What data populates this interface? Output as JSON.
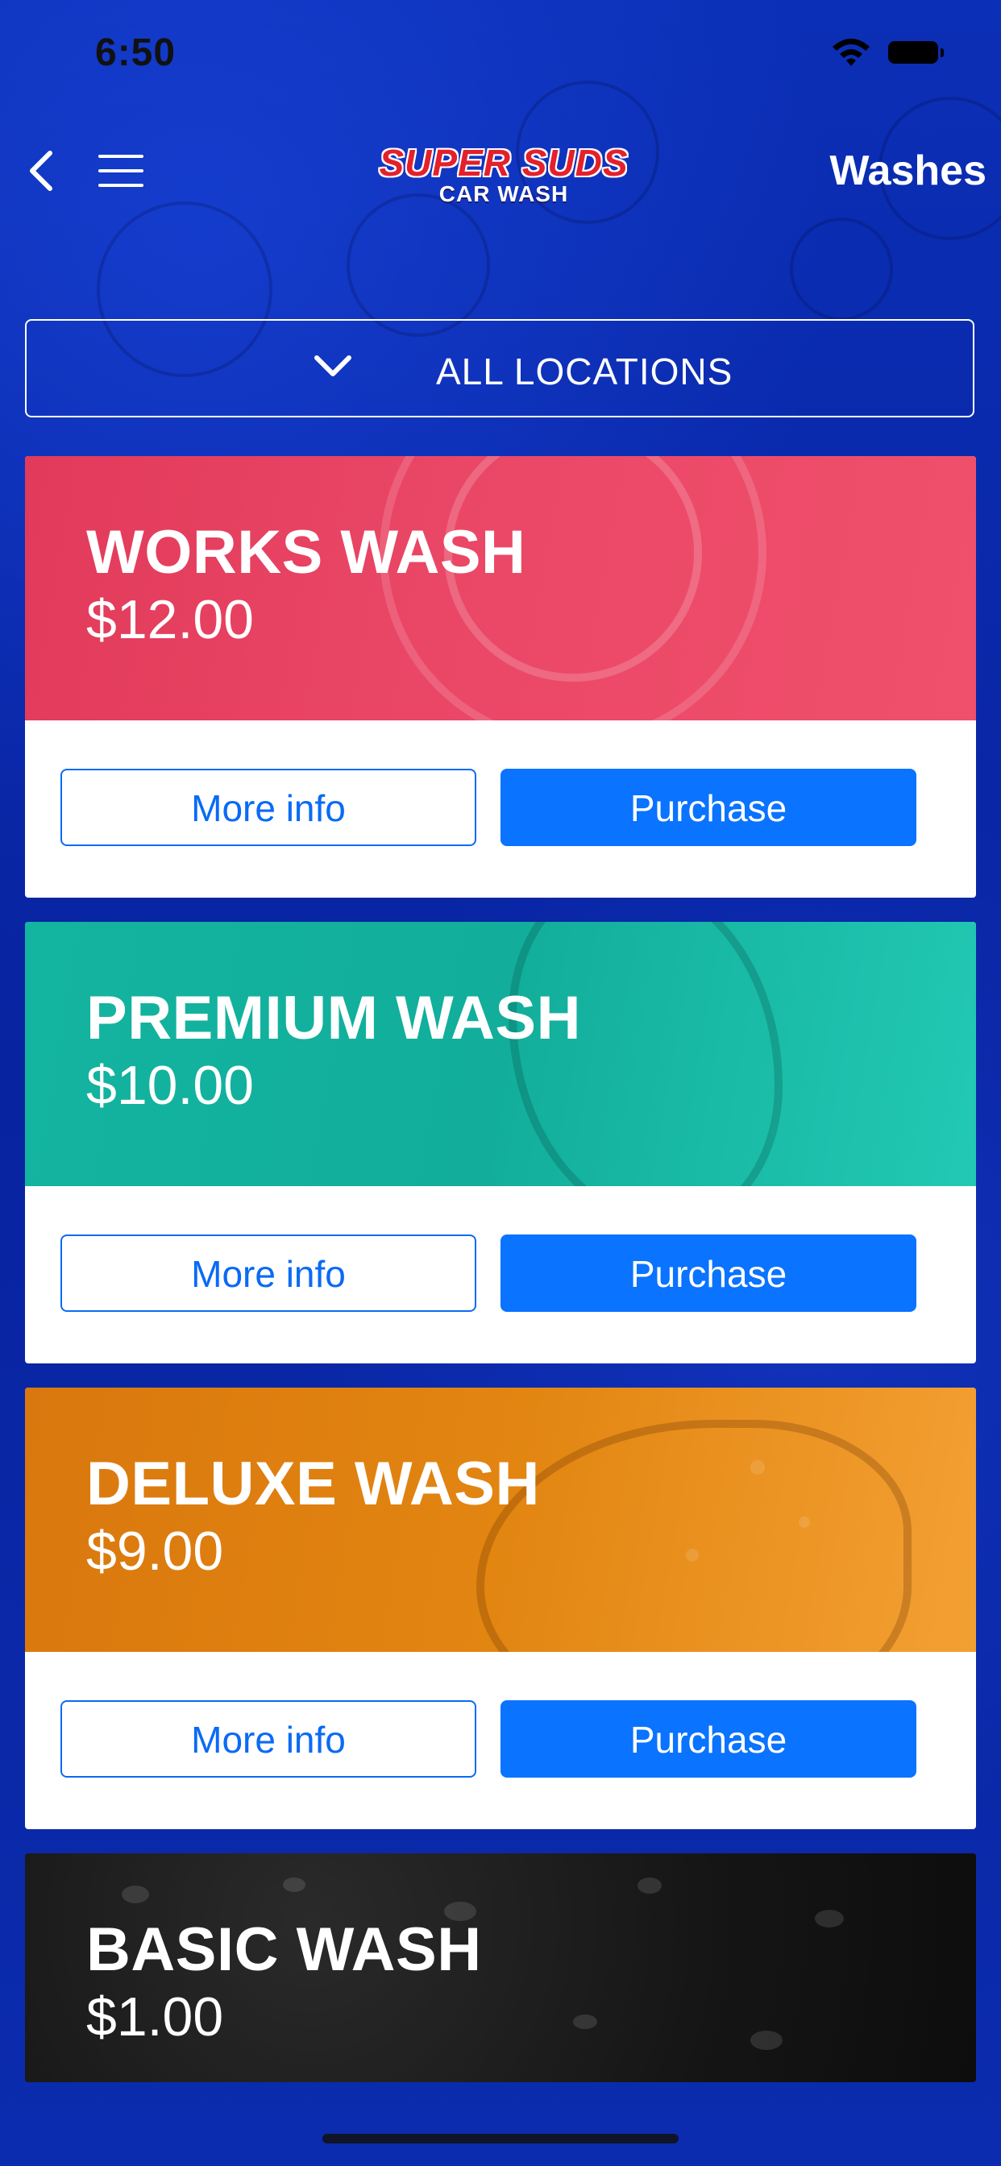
{
  "status_bar": {
    "time": "6:50"
  },
  "nav": {
    "title": "Washes",
    "logo_line1": "SUPER SUDS",
    "logo_line2": "CAR WASH"
  },
  "locations": {
    "label": "ALL LOCATIONS"
  },
  "washes": [
    {
      "title": "WORKS WASH",
      "price": "$12.00",
      "more_label": "More info",
      "buy_label": "Purchase",
      "color": "#E6425F"
    },
    {
      "title": "PREMIUM WASH",
      "price": "$10.00",
      "more_label": "More info",
      "buy_label": "Purchase",
      "color": "#16B3A0"
    },
    {
      "title": "DELUXE WASH",
      "price": "$9.00",
      "more_label": "More info",
      "buy_label": "Purchase",
      "color": "#DF810F"
    },
    {
      "title": "BASIC WASH",
      "price": "$1.00"
    }
  ],
  "colors": {
    "background": "#0A2AA8",
    "primary_button": "#0A73FF",
    "outline_button": "#0A6AF5"
  },
  "icons": {
    "back": "chevron-left-icon",
    "menu": "hamburger-menu-icon",
    "dropdown": "chevron-down-icon",
    "wifi": "wifi-icon",
    "battery": "battery-icon"
  }
}
